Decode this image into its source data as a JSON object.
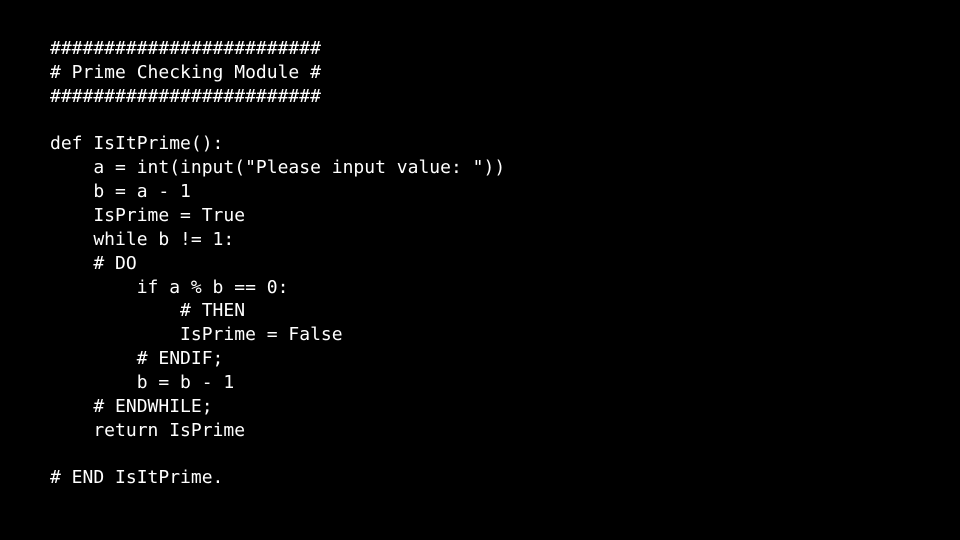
{
  "code": {
    "lines": [
      "#########################",
      "# Prime Checking Module #",
      "#########################",
      "",
      "def IsItPrime():",
      "    a = int(input(\"Please input value: \"))",
      "    b = a - 1",
      "    IsPrime = True",
      "    while b != 1:",
      "    # DO",
      "        if a % b == 0:",
      "            # THEN",
      "            IsPrime = False",
      "        # ENDIF;",
      "        b = b - 1",
      "    # ENDWHILE;",
      "    return IsPrime",
      "",
      "# END IsItPrime."
    ]
  }
}
